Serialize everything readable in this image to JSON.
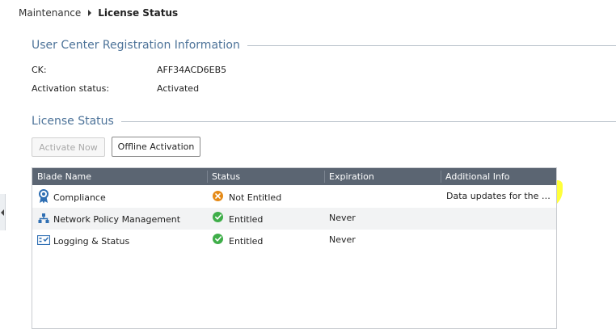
{
  "breadcrumb": {
    "root": "Maintenance",
    "current": "License Status"
  },
  "registration": {
    "title": "User Center Registration Information",
    "ck_label": "CK:",
    "ck_value": "AFF34ACD6EB5",
    "activation_label": "Activation status:",
    "activation_value": "Activated"
  },
  "license": {
    "title": "License Status",
    "activate_now_label": "Activate Now",
    "offline_activation_label": "Offline Activation"
  },
  "table": {
    "columns": [
      "Blade Name",
      "Status",
      "Expiration",
      "Additional Info"
    ],
    "rows": [
      {
        "blade": "Compliance",
        "blade_icon": "compliance-ribbon-icon",
        "status": "Not Entitled",
        "status_icon": "error-x-icon",
        "expiration": "",
        "info": "Data updates for the Co..."
      },
      {
        "blade": "Network Policy Management",
        "blade_icon": "network-tree-icon",
        "status": "Entitled",
        "status_icon": "check-icon",
        "expiration": "Never",
        "info": ""
      },
      {
        "blade": "Logging & Status",
        "blade_icon": "logging-list-icon",
        "status": "Entitled",
        "status_icon": "check-icon",
        "expiration": "Never",
        "info": ""
      }
    ]
  },
  "colors": {
    "section_title": "#4d7399",
    "table_header": "#5b6572",
    "entitled_green": "#3fae49",
    "not_entitled_orange": "#e58a17",
    "highlight_yellow": "#ffff3a",
    "icon_blue": "#2f6fb3"
  }
}
